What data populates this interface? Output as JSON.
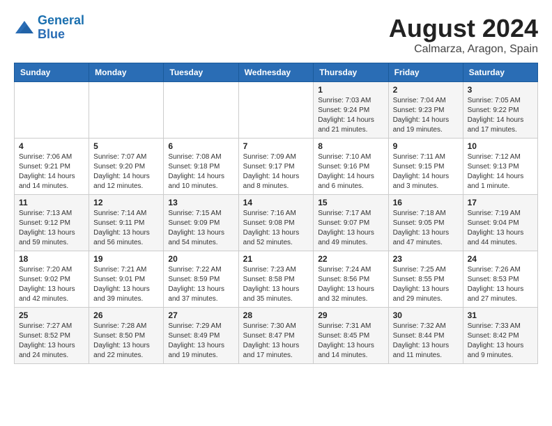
{
  "header": {
    "logo_line1": "General",
    "logo_line2": "Blue",
    "month_year": "August 2024",
    "location": "Calmarza, Aragon, Spain"
  },
  "columns": [
    "Sunday",
    "Monday",
    "Tuesday",
    "Wednesday",
    "Thursday",
    "Friday",
    "Saturday"
  ],
  "weeks": [
    [
      {
        "day": "",
        "info": ""
      },
      {
        "day": "",
        "info": ""
      },
      {
        "day": "",
        "info": ""
      },
      {
        "day": "",
        "info": ""
      },
      {
        "day": "1",
        "info": "Sunrise: 7:03 AM\nSunset: 9:24 PM\nDaylight: 14 hours and 21 minutes."
      },
      {
        "day": "2",
        "info": "Sunrise: 7:04 AM\nSunset: 9:23 PM\nDaylight: 14 hours and 19 minutes."
      },
      {
        "day": "3",
        "info": "Sunrise: 7:05 AM\nSunset: 9:22 PM\nDaylight: 14 hours and 17 minutes."
      }
    ],
    [
      {
        "day": "4",
        "info": "Sunrise: 7:06 AM\nSunset: 9:21 PM\nDaylight: 14 hours and 14 minutes."
      },
      {
        "day": "5",
        "info": "Sunrise: 7:07 AM\nSunset: 9:20 PM\nDaylight: 14 hours and 12 minutes."
      },
      {
        "day": "6",
        "info": "Sunrise: 7:08 AM\nSunset: 9:18 PM\nDaylight: 14 hours and 10 minutes."
      },
      {
        "day": "7",
        "info": "Sunrise: 7:09 AM\nSunset: 9:17 PM\nDaylight: 14 hours and 8 minutes."
      },
      {
        "day": "8",
        "info": "Sunrise: 7:10 AM\nSunset: 9:16 PM\nDaylight: 14 hours and 6 minutes."
      },
      {
        "day": "9",
        "info": "Sunrise: 7:11 AM\nSunset: 9:15 PM\nDaylight: 14 hours and 3 minutes."
      },
      {
        "day": "10",
        "info": "Sunrise: 7:12 AM\nSunset: 9:13 PM\nDaylight: 14 hours and 1 minute."
      }
    ],
    [
      {
        "day": "11",
        "info": "Sunrise: 7:13 AM\nSunset: 9:12 PM\nDaylight: 13 hours and 59 minutes."
      },
      {
        "day": "12",
        "info": "Sunrise: 7:14 AM\nSunset: 9:11 PM\nDaylight: 13 hours and 56 minutes."
      },
      {
        "day": "13",
        "info": "Sunrise: 7:15 AM\nSunset: 9:09 PM\nDaylight: 13 hours and 54 minutes."
      },
      {
        "day": "14",
        "info": "Sunrise: 7:16 AM\nSunset: 9:08 PM\nDaylight: 13 hours and 52 minutes."
      },
      {
        "day": "15",
        "info": "Sunrise: 7:17 AM\nSunset: 9:07 PM\nDaylight: 13 hours and 49 minutes."
      },
      {
        "day": "16",
        "info": "Sunrise: 7:18 AM\nSunset: 9:05 PM\nDaylight: 13 hours and 47 minutes."
      },
      {
        "day": "17",
        "info": "Sunrise: 7:19 AM\nSunset: 9:04 PM\nDaylight: 13 hours and 44 minutes."
      }
    ],
    [
      {
        "day": "18",
        "info": "Sunrise: 7:20 AM\nSunset: 9:02 PM\nDaylight: 13 hours and 42 minutes."
      },
      {
        "day": "19",
        "info": "Sunrise: 7:21 AM\nSunset: 9:01 PM\nDaylight: 13 hours and 39 minutes."
      },
      {
        "day": "20",
        "info": "Sunrise: 7:22 AM\nSunset: 8:59 PM\nDaylight: 13 hours and 37 minutes."
      },
      {
        "day": "21",
        "info": "Sunrise: 7:23 AM\nSunset: 8:58 PM\nDaylight: 13 hours and 35 minutes."
      },
      {
        "day": "22",
        "info": "Sunrise: 7:24 AM\nSunset: 8:56 PM\nDaylight: 13 hours and 32 minutes."
      },
      {
        "day": "23",
        "info": "Sunrise: 7:25 AM\nSunset: 8:55 PM\nDaylight: 13 hours and 29 minutes."
      },
      {
        "day": "24",
        "info": "Sunrise: 7:26 AM\nSunset: 8:53 PM\nDaylight: 13 hours and 27 minutes."
      }
    ],
    [
      {
        "day": "25",
        "info": "Sunrise: 7:27 AM\nSunset: 8:52 PM\nDaylight: 13 hours and 24 minutes."
      },
      {
        "day": "26",
        "info": "Sunrise: 7:28 AM\nSunset: 8:50 PM\nDaylight: 13 hours and 22 minutes."
      },
      {
        "day": "27",
        "info": "Sunrise: 7:29 AM\nSunset: 8:49 PM\nDaylight: 13 hours and 19 minutes."
      },
      {
        "day": "28",
        "info": "Sunrise: 7:30 AM\nSunset: 8:47 PM\nDaylight: 13 hours and 17 minutes."
      },
      {
        "day": "29",
        "info": "Sunrise: 7:31 AM\nSunset: 8:45 PM\nDaylight: 13 hours and 14 minutes."
      },
      {
        "day": "30",
        "info": "Sunrise: 7:32 AM\nSunset: 8:44 PM\nDaylight: 13 hours and 11 minutes."
      },
      {
        "day": "31",
        "info": "Sunrise: 7:33 AM\nSunset: 8:42 PM\nDaylight: 13 hours and 9 minutes."
      }
    ]
  ]
}
